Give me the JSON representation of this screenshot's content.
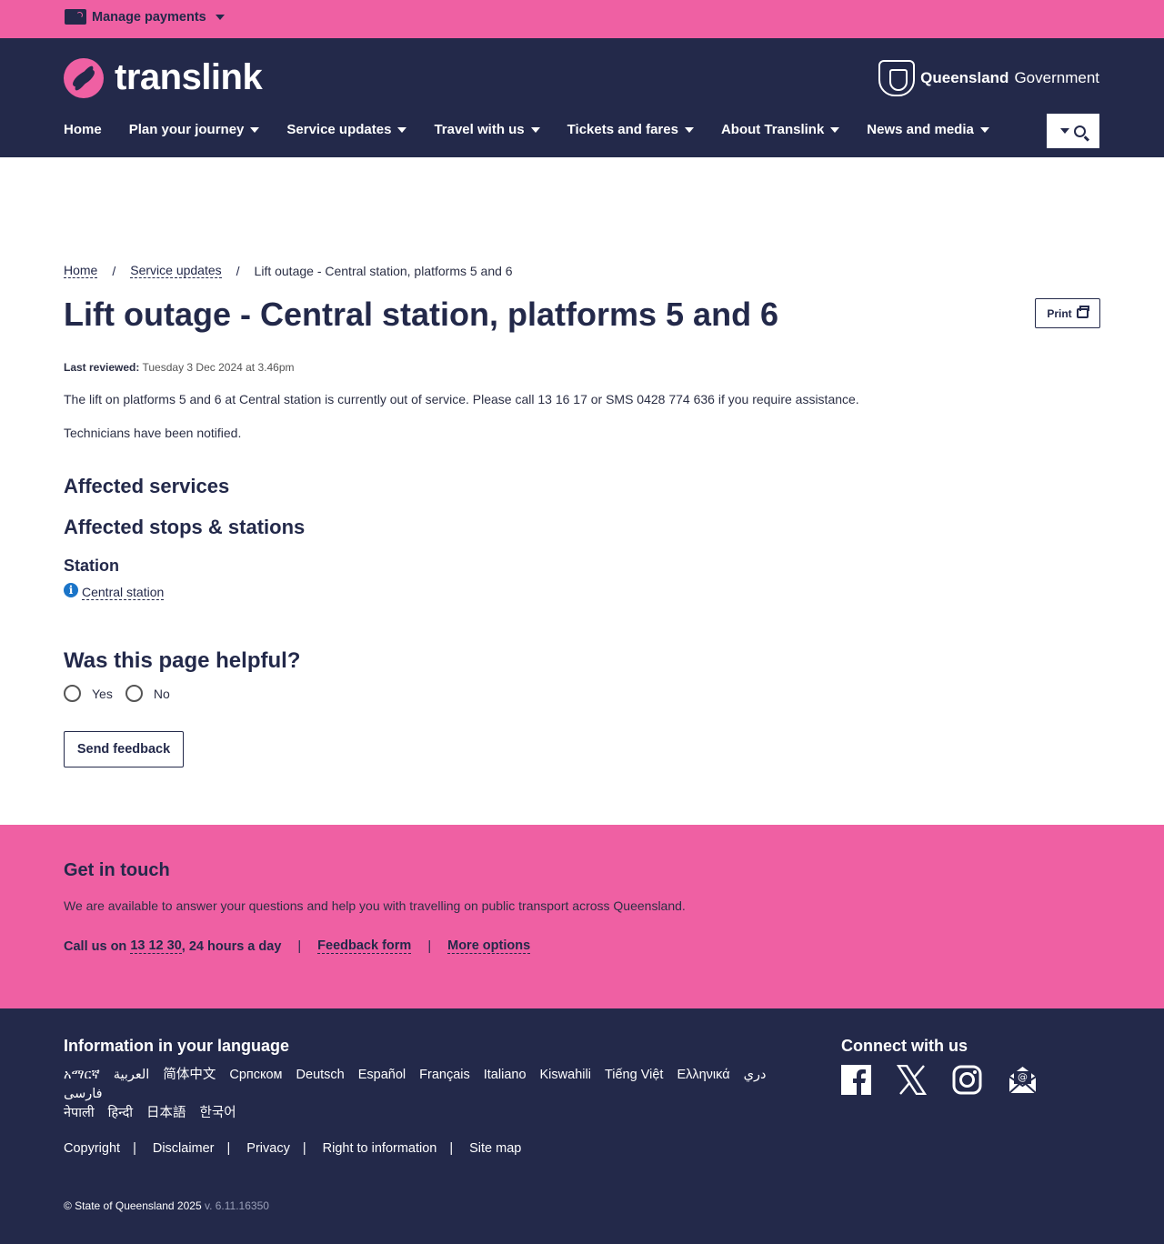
{
  "topbar": {
    "manage_label": "Manage payments"
  },
  "header": {
    "logo_text": "translink",
    "gov_bold": "Queensland",
    "gov_rest": "Government"
  },
  "nav": {
    "items": [
      {
        "label": "Home"
      },
      {
        "label": "Plan your journey"
      },
      {
        "label": "Service updates"
      },
      {
        "label": "Travel with us"
      },
      {
        "label": "Tickets and fares"
      },
      {
        "label": "About Translink"
      },
      {
        "label": "News and media"
      }
    ]
  },
  "breadcrumb": [
    "Home",
    "Service updates",
    "Lift outage - Central station, platforms 5 and 6"
  ],
  "page": {
    "title": "Lift outage - Central station, platforms 5 and 6",
    "print_label": "Print",
    "reviewed_label": "Last reviewed:",
    "reviewed_value": "Tuesday 3 Dec 2024 at 3.46pm",
    "para1": "The lift on platforms 5 and 6 at Central station is currently out of service. Please call 13 16 17 or SMS 0428 774 636 if you require assistance.",
    "para2": "Technicians have been notified.",
    "affected_services": "Affected services",
    "affected_stops": "Affected stops & stations",
    "station_heading": "Station",
    "station_link": "Central station"
  },
  "feedback": {
    "title": "Was this page helpful?",
    "yes": "Yes",
    "no": "No",
    "send": "Send feedback"
  },
  "contact": {
    "title": "Get in touch",
    "desc": "We are available to answer your questions and help you with travelling on public transport across Queensland.",
    "call_prefix": "Call us on",
    "call_number": "13 12 30",
    "call_suffix": ", 24 hours a day",
    "feedback_form": "Feedback form",
    "more_options": "More options"
  },
  "footer": {
    "lang_title": "Information in your language",
    "languages": [
      "አማርኛ",
      "العربية",
      "简体中文",
      "Српском",
      "Deutsch",
      "Español",
      "Français",
      "Italiano",
      "Kiswahili",
      "Tiếng Việt",
      "Ελληνικά",
      "دري",
      "فارسی",
      "नेपाली",
      "हिन्दी",
      "日本語",
      "한국어"
    ],
    "connect_title": "Connect with us",
    "social_icons": [
      "facebook-icon",
      "x-icon",
      "instagram-icon",
      "email-icon"
    ],
    "links": [
      "Copyright",
      "Disclaimer",
      "Privacy",
      "Right to information",
      "Site map"
    ],
    "copyright": "© State of Queensland 2025",
    "version": "v. 6.11.16350"
  },
  "colors": {
    "navy": "#23294a",
    "pink": "#ef60a3",
    "info_blue": "#1a74c8"
  }
}
